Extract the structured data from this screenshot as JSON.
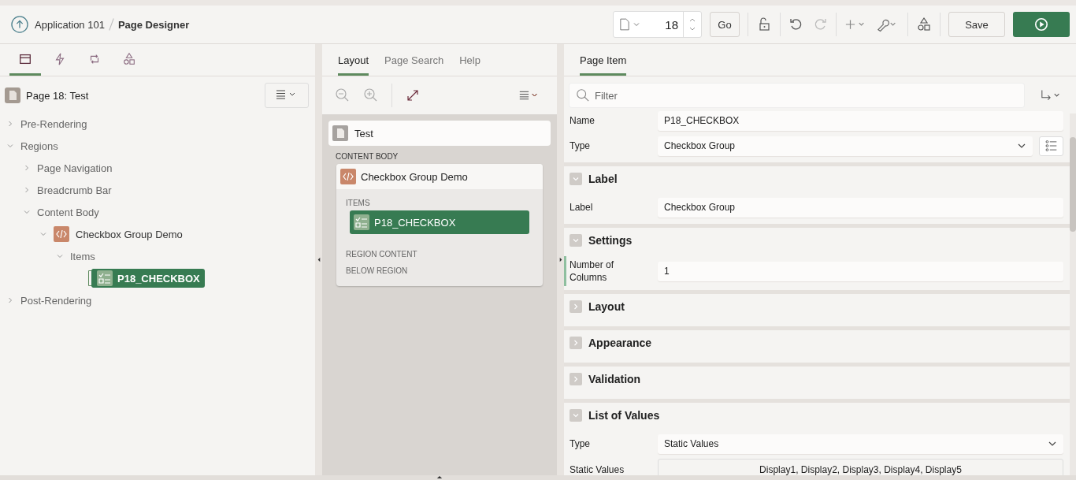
{
  "header": {
    "breadcrumb": [
      {
        "label": "Application 101"
      },
      {
        "label": "Page Designer"
      }
    ],
    "page_number": "18",
    "go": "Go",
    "save": "Save"
  },
  "left": {
    "tabs": [
      {
        "kind": "rendering",
        "selected": true
      },
      {
        "kind": "dynamic-actions",
        "selected": false
      },
      {
        "kind": "processing",
        "selected": false
      },
      {
        "kind": "shared",
        "selected": false
      }
    ],
    "page_title": "Page 18: Test",
    "tree": [
      {
        "label": "Pre-Rendering",
        "kind": "folder",
        "expanded": false,
        "selected": false
      },
      {
        "label": "Regions",
        "kind": "folder",
        "expanded": true,
        "selected": false,
        "children": [
          {
            "label": "Page Navigation",
            "kind": "folder",
            "expanded": false,
            "selected": false
          },
          {
            "label": "Breadcrumb Bar",
            "kind": "folder",
            "expanded": false,
            "selected": false
          },
          {
            "label": "Content Body",
            "kind": "folder",
            "expanded": true,
            "selected": false,
            "children": [
              {
                "label": "Checkbox Group Demo",
                "kind": "region",
                "expanded": true,
                "selected": false,
                "children": [
                  {
                    "label": "Items",
                    "kind": "folder",
                    "expanded": true,
                    "selected": false,
                    "children": [
                      {
                        "label": "P18_CHECKBOX",
                        "kind": "item",
                        "selected": true
                      }
                    ]
                  }
                ]
              }
            ]
          }
        ]
      },
      {
        "label": "Post-Rendering",
        "kind": "folder",
        "expanded": false,
        "selected": false
      }
    ]
  },
  "middle": {
    "tabs": [
      {
        "label": "Layout",
        "selected": true
      },
      {
        "label": "Page Search",
        "selected": false
      },
      {
        "label": "Help",
        "selected": false
      }
    ],
    "page": "Test",
    "position": "CONTENT BODY",
    "region": {
      "title": "Checkbox Group Demo",
      "sections": [
        {
          "label": "ITEMS",
          "items": [
            {
              "label": "P18_CHECKBOX",
              "selected": true
            }
          ]
        },
        {
          "label": "REGION CONTENT"
        },
        {
          "label": "BELOW REGION"
        }
      ]
    }
  },
  "right": {
    "tab": "Page Item",
    "filter_placeholder": "Filter",
    "groups": [
      {
        "properties": [
          {
            "label": "Name",
            "value": "P18_CHECKBOX",
            "kind": "text",
            "current": false
          },
          {
            "label": "Type",
            "value": "Checkbox Group",
            "kind": "select-list",
            "current": false
          }
        ]
      },
      {
        "title": "Label",
        "expanded": true,
        "properties": [
          {
            "label": "Label",
            "value": "Checkbox Group",
            "kind": "text",
            "current": false
          }
        ]
      },
      {
        "title": "Settings",
        "expanded": true,
        "properties": [
          {
            "label": "Number of Columns",
            "value": "1",
            "kind": "text",
            "current": true
          }
        ]
      },
      {
        "title": "Layout",
        "expanded": false
      },
      {
        "title": "Appearance",
        "expanded": false
      },
      {
        "title": "Validation",
        "expanded": false
      },
      {
        "title": "List of Values",
        "expanded": true,
        "properties": [
          {
            "label": "Type",
            "value": "Static Values",
            "kind": "select",
            "current": false
          },
          {
            "label": "Static Values",
            "value": "Display1, Display2, Display3, Display4, Display5",
            "kind": "static",
            "current": false
          }
        ]
      }
    ]
  }
}
